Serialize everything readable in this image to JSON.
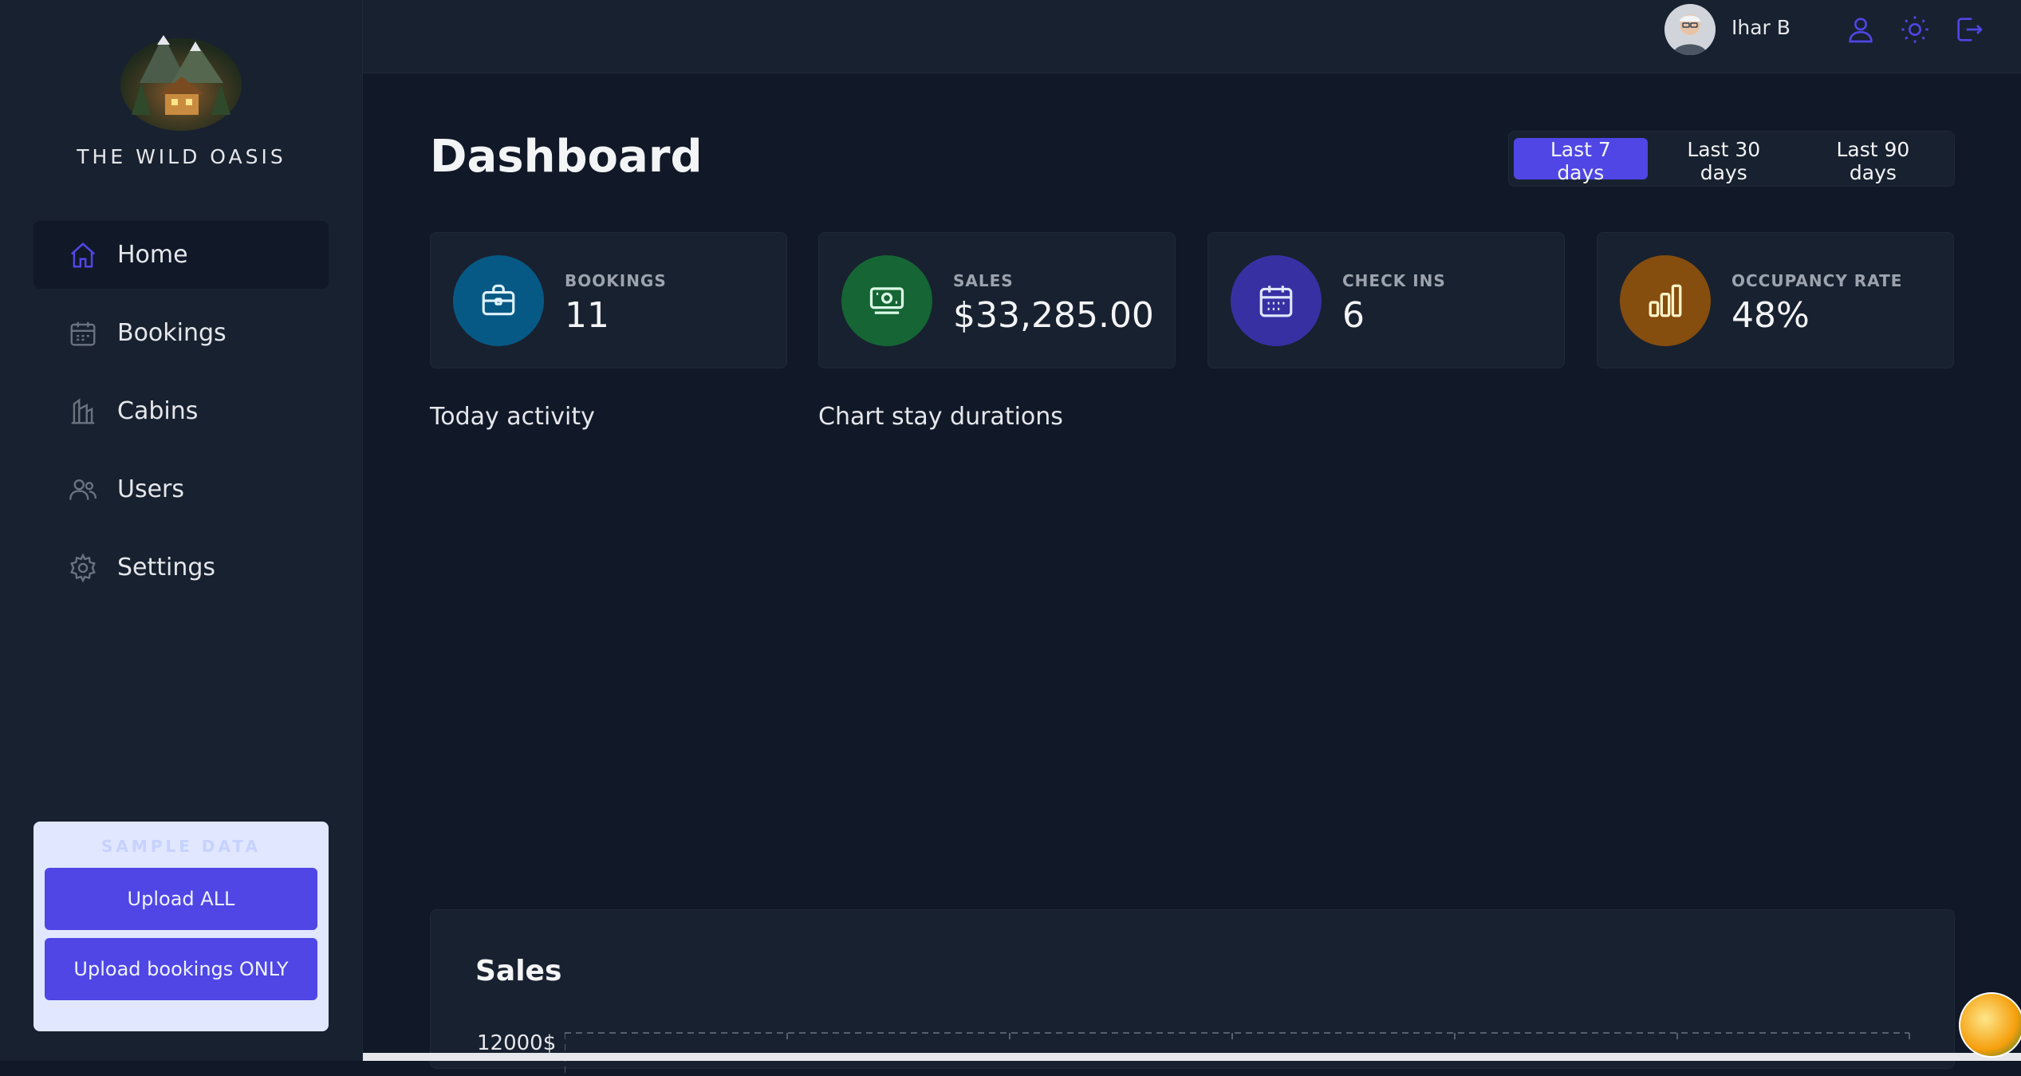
{
  "app": {
    "brand": "THE WILD OASIS"
  },
  "sidebar": {
    "items": [
      {
        "label": "Home",
        "icon": "home-icon",
        "active": true
      },
      {
        "label": "Bookings",
        "icon": "calendar-icon",
        "active": false
      },
      {
        "label": "Cabins",
        "icon": "cabins-icon",
        "active": false
      },
      {
        "label": "Users",
        "icon": "users-icon",
        "active": false
      },
      {
        "label": "Settings",
        "icon": "gear-icon",
        "active": false
      }
    ],
    "sample_data": {
      "title": "SAMPLE DATA",
      "upload_all": "Upload ALL",
      "upload_bookings": "Upload bookings ONLY"
    }
  },
  "header": {
    "username": "Ihar B",
    "icons": [
      "account-icon",
      "sun-icon",
      "logout-icon"
    ]
  },
  "main": {
    "title": "Dashboard",
    "filters": [
      {
        "label": "Last 7 days",
        "active": true
      },
      {
        "label": "Last 30 days",
        "active": false
      },
      {
        "label": "Last 90 days",
        "active": false
      }
    ],
    "stats": [
      {
        "label": "BOOKINGS",
        "value": "11",
        "color": "#075985",
        "icon": "briefcase-icon"
      },
      {
        "label": "SALES",
        "value": "$33,285.00",
        "color": "#166534",
        "icon": "banknotes-icon"
      },
      {
        "label": "CHECK INS",
        "value": "6",
        "color": "#3730a3",
        "icon": "calendar-days-icon"
      },
      {
        "label": "OCCUPANCY RATE",
        "value": "48%",
        "color": "#854d0e",
        "icon": "chart-bar-icon"
      }
    ],
    "today_activity": "Today activity",
    "chart_stay": "Chart stay durations",
    "sales": {
      "title": "Sales",
      "ytick": "12000$"
    }
  },
  "colors": {
    "accent": "#4f46e5",
    "background": "#111827",
    "panel": "#18212f"
  }
}
